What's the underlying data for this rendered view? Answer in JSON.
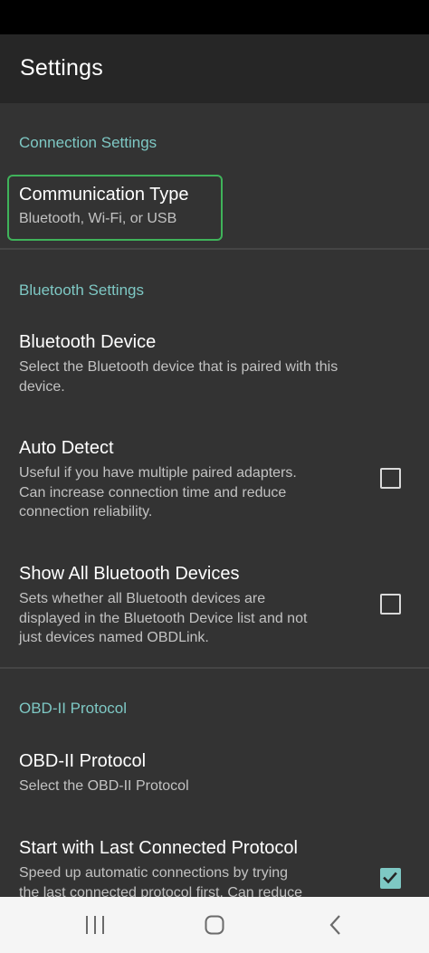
{
  "app": {
    "title": "Settings"
  },
  "sections": {
    "connection": {
      "header": "Connection Settings",
      "communication_type": {
        "title": "Communication Type",
        "summary": "Bluetooth, Wi-Fi, or USB"
      }
    },
    "bluetooth": {
      "header": "Bluetooth Settings",
      "device": {
        "title": "Bluetooth Device",
        "summary_lines": [
          "Select the Bluetooth device that is paired with this",
          "device."
        ]
      },
      "auto_detect": {
        "title": "Auto Detect",
        "summary_lines": [
          "Useful if you have multiple paired adapters.",
          "Can increase connection time and reduce",
          "connection reliability."
        ],
        "checked": false
      },
      "show_all": {
        "title": "Show All Bluetooth Devices",
        "summary_lines": [
          "Sets whether all Bluetooth devices are",
          "displayed in the Bluetooth Device list and not",
          "just devices named OBDLink."
        ],
        "checked": false
      }
    },
    "protocol": {
      "header": "OBD-II Protocol",
      "obd_protocol": {
        "title": "OBD-II Protocol",
        "summary": "Select the OBD-II Protocol"
      },
      "start_last": {
        "title": "Start with Last Connected Protocol",
        "summary_lines": [
          "Speed up automatic connections by trying",
          "the last connected protocol first. Can reduce"
        ],
        "checked": true
      }
    }
  },
  "colors": {
    "accent": "#7ec8c4",
    "highlight": "#3fb35a",
    "background": "#333333",
    "app_bar": "#262626"
  },
  "nav": {
    "icons": [
      "recent-apps-icon",
      "home-icon",
      "back-icon"
    ]
  }
}
